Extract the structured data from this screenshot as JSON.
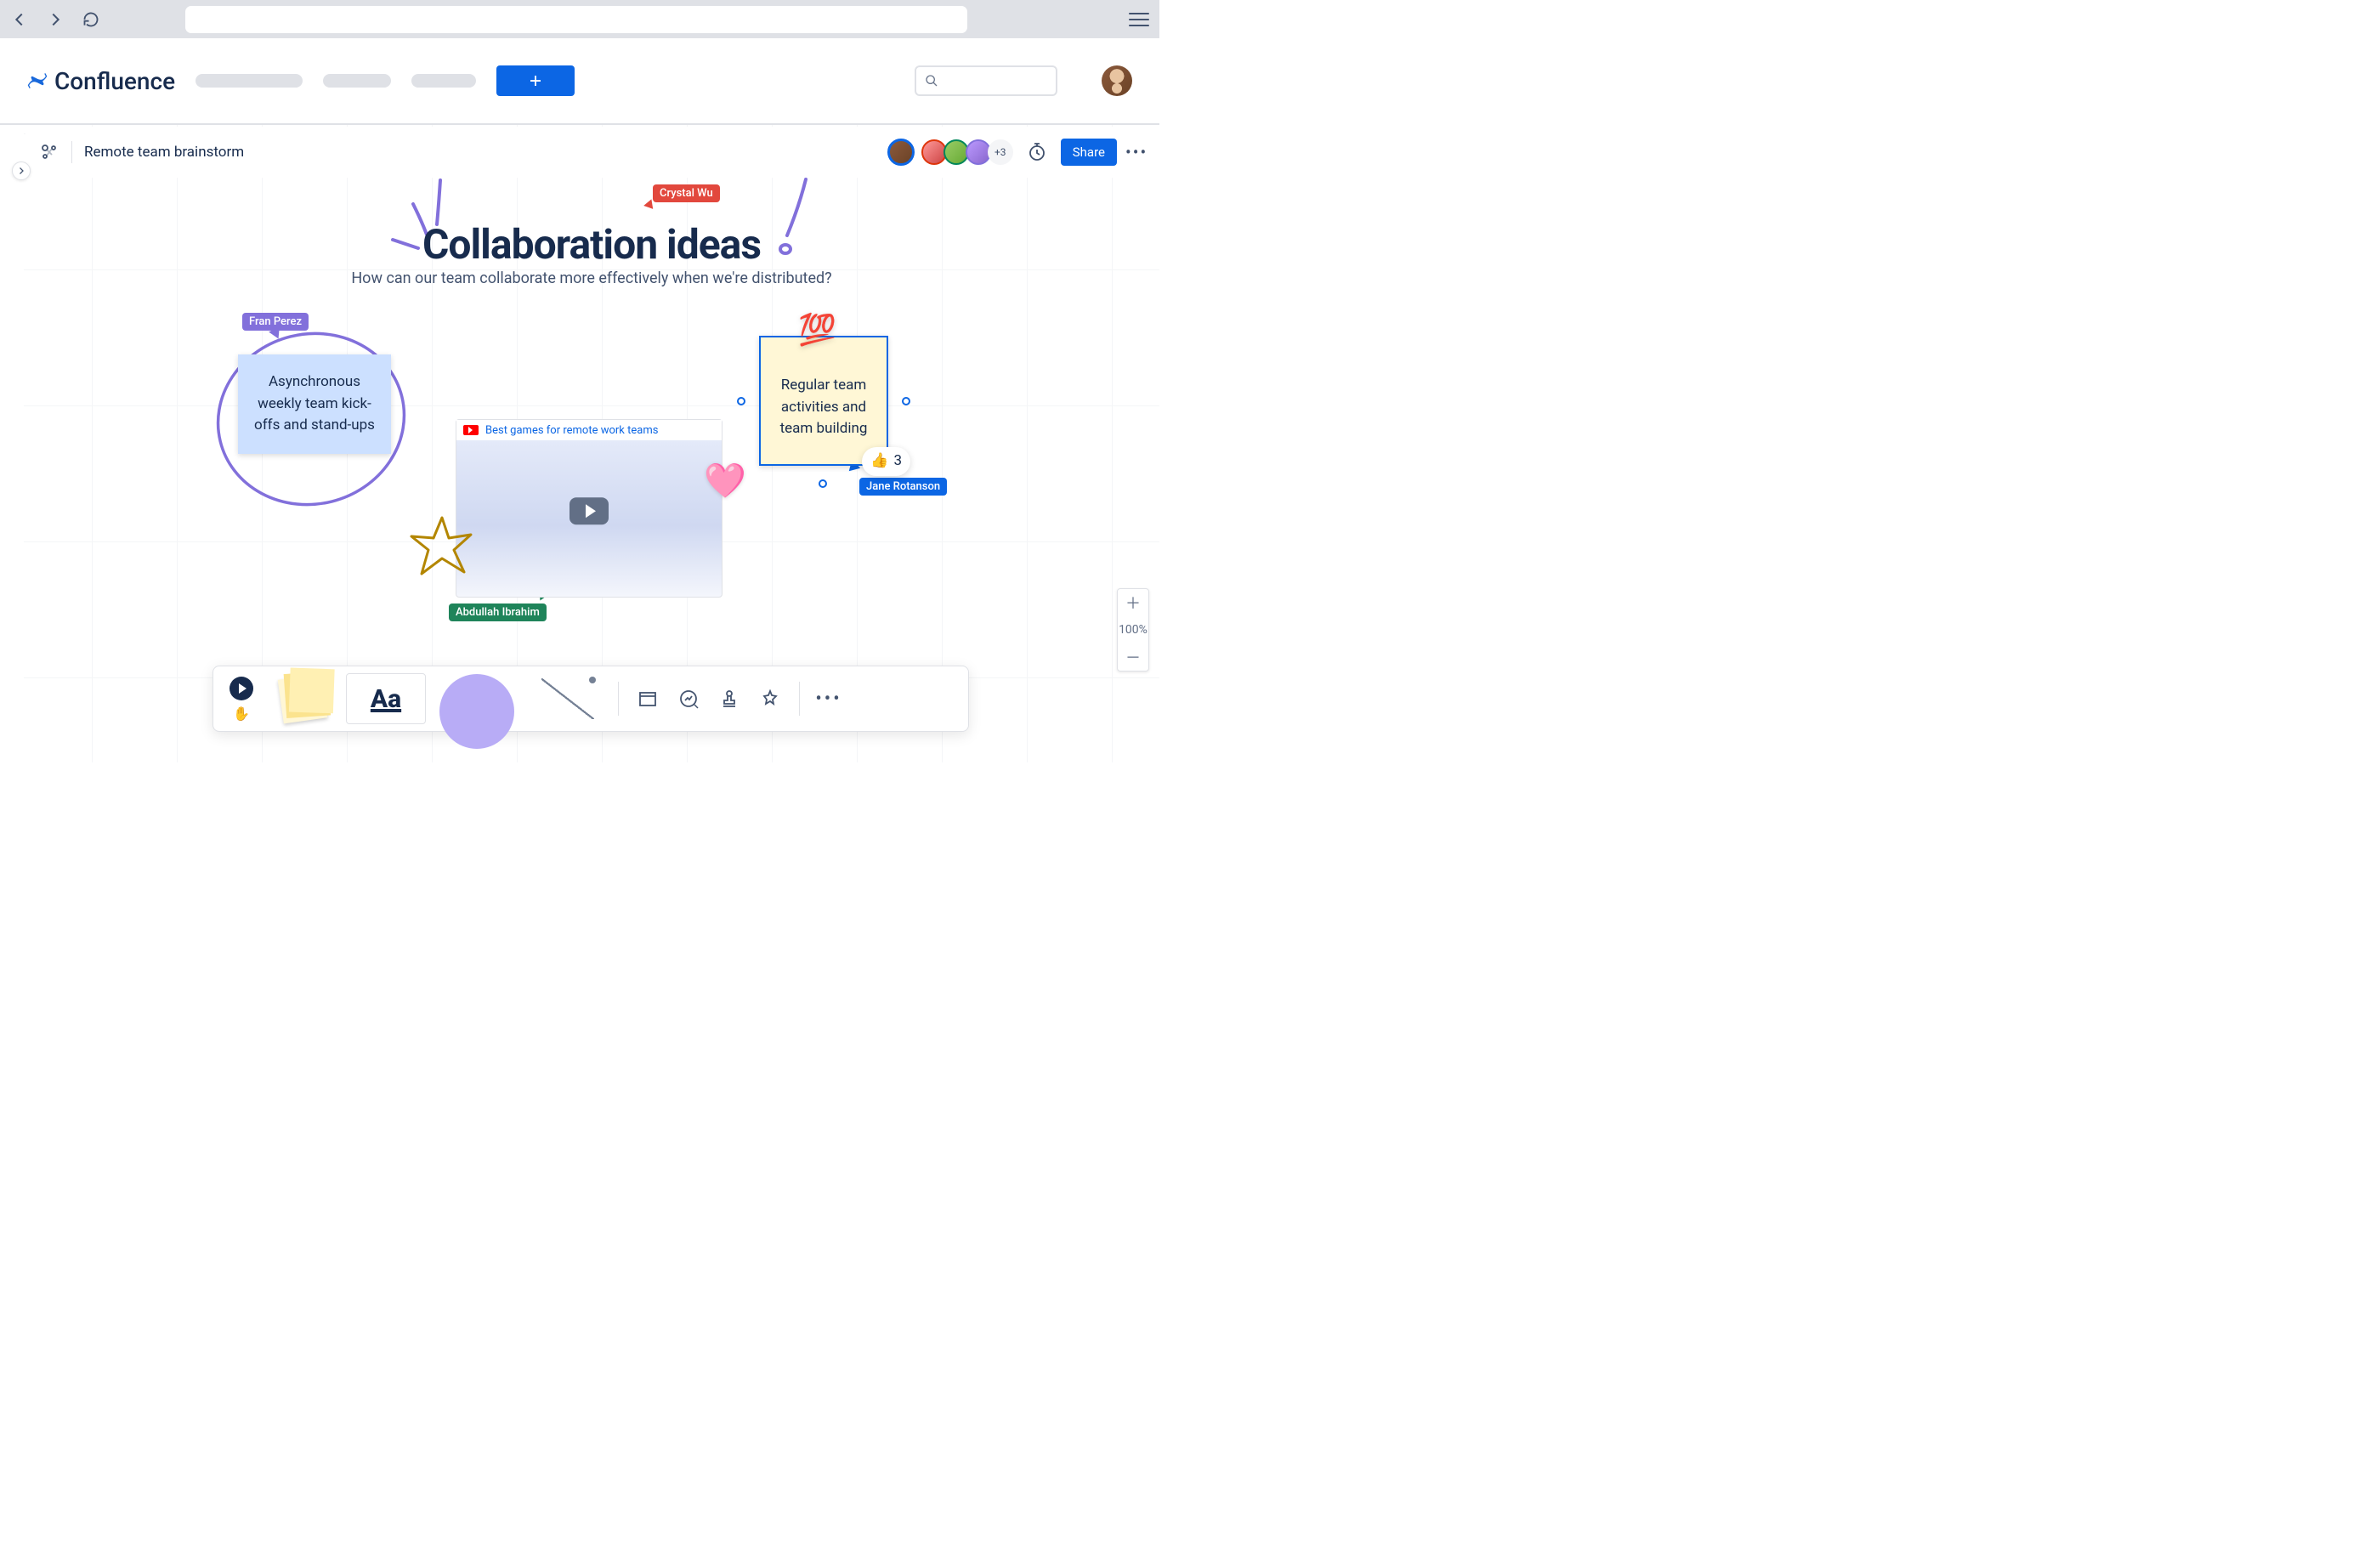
{
  "app": {
    "logo_text": "Confluence"
  },
  "page": {
    "title": "Remote team brainstorm"
  },
  "header_actions": {
    "share_label": "Share",
    "presence_more": "+3"
  },
  "canvas": {
    "title": "Collaboration ideas",
    "subtitle": "How can our team collaborate more effectively when we're distributed?"
  },
  "cursors": {
    "red": "Crystal Wu",
    "purple": "Fran Perez",
    "green": "Abdullah Ibrahim",
    "blue": "Jane Rotanson"
  },
  "stickies": {
    "blue": "Asynchronous weekly team kick-offs and stand-ups",
    "yellow": "Regular team activities and team building",
    "yellow_reaction_count": "3"
  },
  "video": {
    "title": "Best games for remote work teams"
  },
  "zoom": {
    "level": "100%"
  },
  "toolbox": {
    "text_label": "Aa"
  }
}
